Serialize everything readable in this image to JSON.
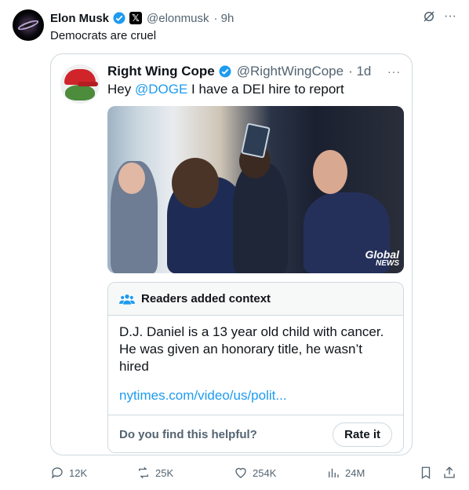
{
  "tweet": {
    "author_name": "Elon Musk",
    "author_handle": "@elonmusk",
    "time": "· 9h",
    "text": "Democrats are cruel"
  },
  "quote": {
    "author_name": "Right Wing Cope",
    "author_handle": "@RightWingCope",
    "time": "· 1d",
    "text_before": "Hey ",
    "mention": "@DOGE",
    "text_after": " I have a DEI hire to report",
    "photo_logo_line1": "Global",
    "photo_logo_line2": "NEWS"
  },
  "context": {
    "title": "Readers added context",
    "body": "D.J. Daniel is a 13 year old child with cancer. He was given an honorary title, he wasn’t hired",
    "link": "nytimes.com/video/us/polit...",
    "question": "Do you find this helpful?",
    "rate_label": "Rate it"
  },
  "actions": {
    "replies": "12K",
    "reposts": "25K",
    "likes": "254K",
    "views": "24M"
  },
  "colors": {
    "accent": "#1d9bf0",
    "muted": "#536471",
    "border": "#cfd9de"
  }
}
